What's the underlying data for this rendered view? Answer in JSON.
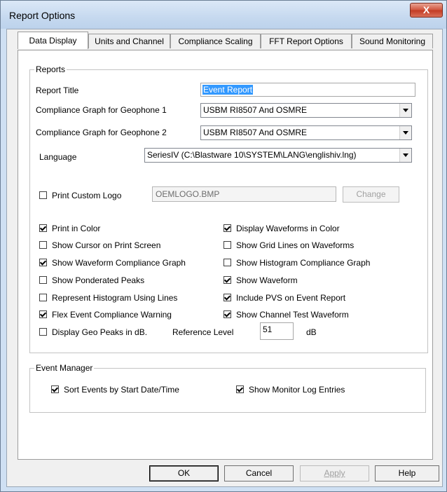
{
  "window": {
    "title": "Report Options",
    "close_glyph": "X"
  },
  "tabs": [
    {
      "label": "Data Display",
      "active": true
    },
    {
      "label": "Units and Channel",
      "active": false
    },
    {
      "label": "Compliance Scaling",
      "active": false
    },
    {
      "label": "FFT Report Options",
      "active": false
    },
    {
      "label": "Sound Monitoring",
      "active": false
    }
  ],
  "reports": {
    "legend": "Reports",
    "report_title_label": "Report Title",
    "report_title_value": "Event Report",
    "geo1_label": "Compliance Graph for Geophone 1",
    "geo1_value": "USBM RI8507 And OSMRE",
    "geo2_label": "Compliance Graph for Geophone 2",
    "geo2_value": "USBM RI8507 And OSMRE",
    "language_label": "Language",
    "language_value": "SeriesIV (C:\\Blastware 10\\SYSTEM\\LANG\\englishiv.lng)",
    "print_custom_logo_label": "Print Custom Logo",
    "print_custom_logo_checked": false,
    "logo_file": "OEMLOGO.BMP",
    "change_button": "Change",
    "options_left": [
      {
        "label": "Print in Color",
        "checked": true
      },
      {
        "label": "Show Cursor on Print Screen",
        "checked": false
      },
      {
        "label": "Show Waveform Compliance Graph",
        "checked": true
      },
      {
        "label": "Show Ponderated Peaks",
        "checked": false
      },
      {
        "label": "Represent Histogram Using Lines",
        "checked": false
      },
      {
        "label": "Flex Event Compliance Warning",
        "checked": true
      }
    ],
    "options_right": [
      {
        "label": "Display Waveforms in Color",
        "checked": true
      },
      {
        "label": "Show Grid Lines on Waveforms",
        "checked": false
      },
      {
        "label": "Show Histogram Compliance Graph",
        "checked": false
      },
      {
        "label": "Show Waveform",
        "checked": true
      },
      {
        "label": "Include PVS on Event Report",
        "checked": true
      },
      {
        "label": "Show Channel Test Waveform",
        "checked": true
      }
    ],
    "geo_peaks_db_label": "Display Geo Peaks in dB.",
    "geo_peaks_db_checked": false,
    "reference_level_label": "Reference Level",
    "reference_level_value": "51",
    "db_unit": "dB"
  },
  "event_manager": {
    "legend": "Event Manager",
    "sort_events_label": "Sort  Events by Start Date/Time",
    "sort_events_checked": true,
    "show_monitor_log_label": "Show Monitor Log Entries",
    "show_monitor_log_checked": true
  },
  "buttons": {
    "ok": "OK",
    "cancel": "Cancel",
    "apply": "Apply",
    "help": "Help"
  }
}
